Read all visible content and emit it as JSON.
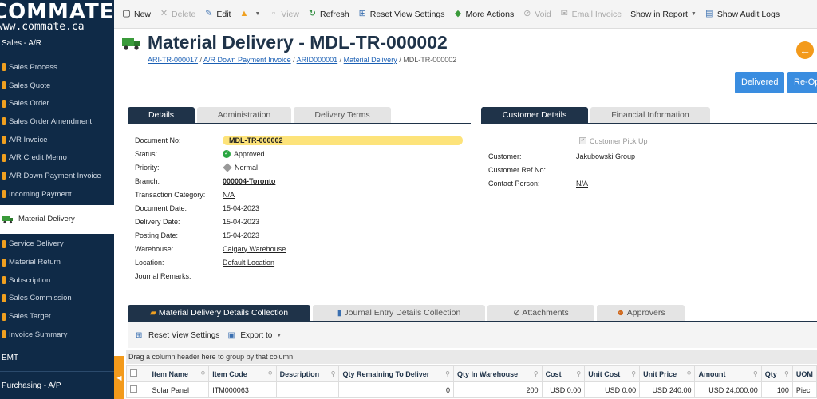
{
  "sidebar": {
    "logo_brand": "COMMATE",
    "logo_domain": "www.commate.ca",
    "section": "Sales - A/R",
    "items": [
      {
        "label": "Sales Process"
      },
      {
        "label": "Sales Quote"
      },
      {
        "label": "Sales Order"
      },
      {
        "label": "Sales Order Amendment"
      },
      {
        "label": "A/R Invoice"
      },
      {
        "label": "A/R Credit Memo"
      },
      {
        "label": "A/R Down Payment Invoice"
      },
      {
        "label": "Incoming Payment"
      },
      {
        "label": "Material Delivery",
        "active": true
      },
      {
        "label": "Service Delivery"
      },
      {
        "label": "Material Return"
      },
      {
        "label": "Subscription"
      },
      {
        "label": "Sales Commission"
      },
      {
        "label": "Sales Target"
      },
      {
        "label": "Invoice Summary"
      }
    ],
    "emt": "EMT",
    "purchasing": "Purchasing - A/P",
    "collapse_arrow": "◀"
  },
  "toolbar": {
    "new": "New",
    "delete": "Delete",
    "edit": "Edit",
    "view": "View",
    "refresh": "Refresh",
    "reset_view": "Reset View Settings",
    "more_actions": "More Actions",
    "void": "Void",
    "email_invoice": "Email Invoice",
    "show_in_report": "Show in Report",
    "show_audit_logs": "Show Audit Logs"
  },
  "header": {
    "title": "Material Delivery - MDL-TR-000002",
    "breadcrumbs": [
      "ARI-TR-000017",
      "A/R Down Payment Invoice",
      "ARID000001",
      "Material Delivery"
    ],
    "breadcrumb_current": "MDL-TR-000002",
    "btn_delivered": "Delivered",
    "btn_reopen": "Re-Op"
  },
  "left_tabs": [
    "Details",
    "Administration",
    "Delivery Terms"
  ],
  "right_tabs": [
    "Customer Details",
    "Financial Information"
  ],
  "details": {
    "document_no_label": "Document No:",
    "document_no": "MDL-TR-000002",
    "status_label": "Status:",
    "status": "Approved",
    "priority_label": "Priority:",
    "priority": "Normal",
    "branch_label": "Branch:",
    "branch": "000004-Toronto",
    "transaction_category_label": "Transaction Category:",
    "transaction_category": "N/A",
    "document_date_label": "Document Date:",
    "document_date": "15-04-2023",
    "delivery_date_label": "Delivery Date:",
    "delivery_date": "15-04-2023",
    "posting_date_label": "Posting Date:",
    "posting_date": "15-04-2023",
    "warehouse_label": "Warehouse:",
    "warehouse": "Calgary Warehouse",
    "location_label": "Location:",
    "location": "Default Location",
    "journal_remarks_label": "Journal Remarks:"
  },
  "customer": {
    "pickup_label": "Customer Pick Up",
    "customer_label": "Customer:",
    "customer": "Jakubowski Group",
    "ref_no_label": "Customer Ref No:",
    "contact_label": "Contact Person:",
    "contact": "N/A"
  },
  "grid": {
    "tabs": [
      "Material Delivery Details Collection",
      "Journal Entry Details Collection",
      "Attachments",
      "Approvers"
    ],
    "reset_view": "Reset View Settings",
    "export_to": "Export to",
    "group_hint": "Drag a column header here to group by that column",
    "columns": [
      "Item Name",
      "Item Code",
      "Description",
      "Qty Remaining To Deliver",
      "Qty In Warehouse",
      "Cost",
      "Unit Cost",
      "Unit Price",
      "Amount",
      "Qty",
      "UOM"
    ],
    "rows": [
      {
        "item_name": "Solar Panel",
        "item_code": "ITM000063",
        "description": "",
        "qty_remaining": "0",
        "qty_in_warehouse": "200",
        "cost": "USD 0.00",
        "unit_cost": "USD 0.00",
        "unit_price": "USD 240.00",
        "amount": "USD 24,000.00",
        "qty": "100",
        "uom": "Piec"
      }
    ]
  }
}
